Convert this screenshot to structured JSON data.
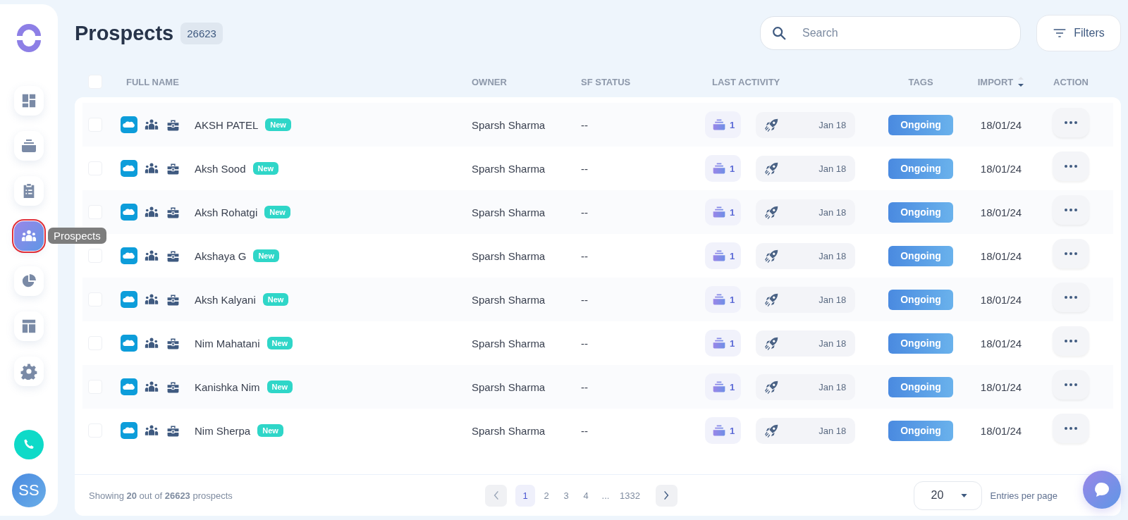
{
  "sidebar": {
    "items": [
      {
        "selected": false
      },
      {
        "selected": false
      },
      {
        "selected": false
      },
      {
        "selected": true
      },
      {
        "selected": false
      },
      {
        "selected": false
      },
      {
        "selected": false
      }
    ],
    "tooltip": "Prospects",
    "avatar": "SS"
  },
  "header": {
    "title": "Prospects",
    "count": "26623"
  },
  "search": {
    "placeholder": "Search"
  },
  "filters_button": "Filters",
  "table": {
    "header_checked": false,
    "columns": [
      "FULL NAME",
      "OWNER",
      "SF STATUS",
      "LAST ACTIVITY",
      "TAGS",
      "IMPORT",
      "ACTION"
    ],
    "rows": [
      {
        "checked": false,
        "name": "AKSH PATEL",
        "badge": "New",
        "owner": "Sparsh Sharma",
        "sf_status": "--",
        "sequence_count": "1",
        "activity_date": "Jan 18",
        "tag": "Ongoing",
        "import": "18/01/24"
      },
      {
        "checked": false,
        "name": "Aksh Sood",
        "badge": "New",
        "owner": "Sparsh Sharma",
        "sf_status": "--",
        "sequence_count": "1",
        "activity_date": "Jan 18",
        "tag": "Ongoing",
        "import": "18/01/24"
      },
      {
        "checked": false,
        "name": "Aksh Rohatgi",
        "badge": "New",
        "owner": "Sparsh Sharma",
        "sf_status": "--",
        "sequence_count": "1",
        "activity_date": "Jan 18",
        "tag": "Ongoing",
        "import": "18/01/24"
      },
      {
        "checked": false,
        "name": "Akshaya G",
        "badge": "New",
        "owner": "Sparsh Sharma",
        "sf_status": "--",
        "sequence_count": "1",
        "activity_date": "Jan 18",
        "tag": "Ongoing",
        "import": "18/01/24"
      },
      {
        "checked": false,
        "name": "Aksh Kalyani",
        "badge": "New",
        "owner": "Sparsh Sharma",
        "sf_status": "--",
        "sequence_count": "1",
        "activity_date": "Jan 18",
        "tag": "Ongoing",
        "import": "18/01/24"
      },
      {
        "checked": false,
        "name": "Nim Mahatani",
        "badge": "New",
        "owner": "Sparsh Sharma",
        "sf_status": "--",
        "sequence_count": "1",
        "activity_date": "Jan 18",
        "tag": "Ongoing",
        "import": "18/01/24"
      },
      {
        "checked": false,
        "name": "Kanishka Nim",
        "badge": "New",
        "owner": "Sparsh Sharma",
        "sf_status": "--",
        "sequence_count": "1",
        "activity_date": "Jan 18",
        "tag": "Ongoing",
        "import": "18/01/24"
      },
      {
        "checked": false,
        "name": "Nim Sherpa",
        "badge": "New",
        "owner": "Sparsh Sharma",
        "sf_status": "--",
        "sequence_count": "1",
        "activity_date": "Jan 18",
        "tag": "Ongoing",
        "import": "18/01/24"
      }
    ]
  },
  "footer": {
    "summary": "Showing **20** out of **26623** prospects",
    "pages": [
      {
        "label": "1",
        "selected": true
      },
      {
        "label": "2",
        "selected": false
      },
      {
        "label": "3",
        "selected": false
      },
      {
        "label": "4",
        "selected": false
      },
      {
        "label": "...",
        "selected": false
      },
      {
        "label": "1332",
        "selected": false
      }
    ],
    "page_size": "20",
    "page_size_label": "Entries per page"
  }
}
